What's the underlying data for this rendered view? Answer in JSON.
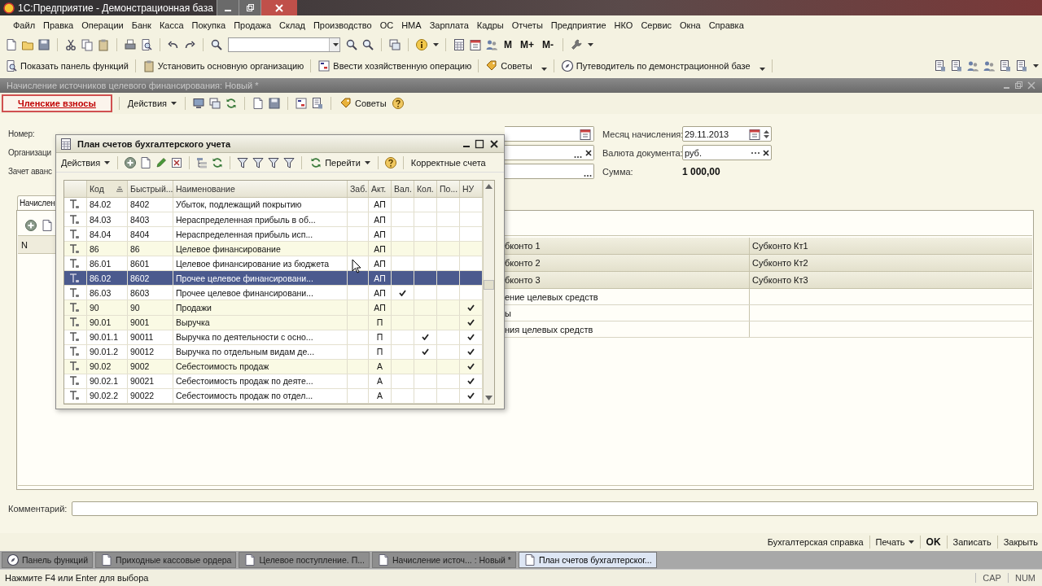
{
  "app_window": {
    "title": "1С:Предприятие - Демонстрационная база"
  },
  "menu": [
    "Файл",
    "Правка",
    "Операции",
    "Банк",
    "Касса",
    "Покупка",
    "Продажа",
    "Склад",
    "Производство",
    "ОС",
    "НМА",
    "Зарплата",
    "Кадры",
    "Отчеты",
    "Предприятие",
    "НКО",
    "Сервис",
    "Окна",
    "Справка"
  ],
  "toolbar": {
    "memory_buttons": [
      "M",
      "M+",
      "M-"
    ]
  },
  "function_bar": [
    {
      "label": "Показать панель функций",
      "dropdown": false
    },
    {
      "label": "Установить основную организацию",
      "dropdown": false
    },
    {
      "label": "Ввести хозяйственную операцию",
      "dropdown": false
    },
    {
      "label": "Советы",
      "dropdown": true
    },
    {
      "label": "Путеводитель по демонстрационной базе",
      "dropdown": true
    }
  ],
  "document": {
    "title": "Начисление источников целевого финансирования: Новый *",
    "toolbar": {
      "mode_button": "Членские взносы",
      "actions": "Действия",
      "tips": "Советы"
    },
    "left_labels": [
      "Номер:",
      "Организаци",
      "Зачет аванс"
    ],
    "right_fields": [
      {
        "label": "Месяц начисления:",
        "value": "29.11.2013",
        "kind": "date"
      },
      {
        "label": "Валюта документа:",
        "value": "руб.",
        "kind": "reference"
      },
      {
        "label": "Сумма:",
        "value": "1 000,00",
        "kind": "total"
      }
    ],
    "tab": {
      "label": "Начислен",
      "selected": true
    },
    "table": {
      "column_1": "N",
      "rows": [
        {
          "kind": "header",
          "column_2": "бконто 1",
          "column_3": "Субконто Кт1"
        },
        {
          "kind": "header",
          "column_2": "бконто 2",
          "column_3": "Субконто Кт2"
        },
        {
          "kind": "header",
          "column_2": "бконто 3",
          "column_3": "Субконто Кт3"
        },
        {
          "kind": "data",
          "column_2": "ение целевых средств"
        },
        {
          "kind": "data",
          "column_2": "ы"
        },
        {
          "kind": "data",
          "column_2": "ния целевых средств"
        }
      ]
    },
    "comment": {
      "label": "Комментарий:"
    },
    "buttons": [
      {
        "label": "Бухгалтерская справка",
        "dropdown": false,
        "default": false
      },
      {
        "label": "Печать",
        "dropdown": true,
        "default": false
      },
      {
        "label": "OK",
        "dropdown": false,
        "default": true
      },
      {
        "label": "Записать",
        "dropdown": false,
        "default": false
      },
      {
        "label": "Закрыть",
        "dropdown": false,
        "default": false
      }
    ]
  },
  "dialog": {
    "title": "План счетов бухгалтерского учета",
    "toolbar": {
      "actions": "Действия",
      "go": "Перейти",
      "correct": "Корректные счета"
    },
    "columns": [
      {
        "kind": "icon",
        "sorted": false
      },
      {
        "label": "Код",
        "kind": "text",
        "sorted": true
      },
      {
        "label": "Быстрый...",
        "kind": "text",
        "sorted": false
      },
      {
        "label": "Наименование",
        "kind": "text",
        "sorted": false
      },
      {
        "label": "Заб.",
        "kind": "check",
        "sorted": false
      },
      {
        "label": "Акт.",
        "kind": "center",
        "sorted": false
      },
      {
        "label": "Вал.",
        "kind": "check",
        "sorted": false
      },
      {
        "label": "Кол.",
        "kind": "check",
        "sorted": false
      },
      {
        "label": "По...",
        "kind": "check",
        "sorted": false
      },
      {
        "label": "НУ",
        "kind": "check",
        "sorted": false
      }
    ],
    "rows": [
      {
        "group": false,
        "selected": false,
        "values": [
          "84.02",
          "8402",
          "Убыток, подлежащий покрытию",
          false,
          "АП",
          false,
          false,
          false,
          false
        ]
      },
      {
        "group": false,
        "selected": false,
        "values": [
          "84.03",
          "8403",
          "Нераспределенная прибыль в об...",
          false,
          "АП",
          false,
          false,
          false,
          false
        ]
      },
      {
        "group": false,
        "selected": false,
        "values": [
          "84.04",
          "8404",
          "Нераспределенная прибыль исп...",
          false,
          "АП",
          false,
          false,
          false,
          false
        ]
      },
      {
        "group": true,
        "selected": false,
        "values": [
          "86",
          "86",
          "Целевое финансирование",
          false,
          "АП",
          false,
          false,
          false,
          false
        ]
      },
      {
        "group": false,
        "selected": false,
        "values": [
          "86.01",
          "8601",
          "Целевое финансирование из бюджета",
          false,
          "АП",
          false,
          false,
          false,
          false
        ]
      },
      {
        "group": false,
        "selected": true,
        "values": [
          "86.02",
          "8602",
          "Прочее целевое финансировани...",
          false,
          "АП",
          false,
          false,
          false,
          false
        ]
      },
      {
        "group": false,
        "selected": false,
        "values": [
          "86.03",
          "8603",
          "Прочее целевое финансировани...",
          false,
          "АП",
          true,
          false,
          false,
          false
        ]
      },
      {
        "group": true,
        "selected": false,
        "values": [
          "90",
          "90",
          "Продажи",
          false,
          "АП",
          false,
          false,
          false,
          true
        ]
      },
      {
        "group": true,
        "selected": false,
        "values": [
          "90.01",
          "9001",
          "Выручка",
          false,
          "П",
          false,
          false,
          false,
          true
        ]
      },
      {
        "group": false,
        "selected": false,
        "values": [
          "90.01.1",
          "90011",
          "Выручка по деятельности с осно...",
          false,
          "П",
          false,
          true,
          false,
          true
        ]
      },
      {
        "group": false,
        "selected": false,
        "values": [
          "90.01.2",
          "90012",
          "Выручка по отдельным видам де...",
          false,
          "П",
          false,
          true,
          false,
          true
        ]
      },
      {
        "group": true,
        "selected": false,
        "values": [
          "90.02",
          "9002",
          "Себестоимость продаж",
          false,
          "А",
          false,
          false,
          false,
          true
        ]
      },
      {
        "group": false,
        "selected": false,
        "values": [
          "90.02.1",
          "90021",
          "Себестоимость продаж по деяте...",
          false,
          "А",
          false,
          false,
          false,
          true
        ]
      },
      {
        "group": false,
        "selected": false,
        "values": [
          "90.02.2",
          "90022",
          "Себестоимость продаж по отдел...",
          false,
          "А",
          false,
          false,
          false,
          true
        ]
      }
    ]
  },
  "taskbar": [
    {
      "label": "Панель функций",
      "selected": false
    },
    {
      "label": "Приходные кассовые ордера",
      "selected": false
    },
    {
      "label": "Целевое поступление. П...",
      "selected": false
    },
    {
      "label": "Начисление источ... : Новый *",
      "selected": false
    },
    {
      "label": "План счетов бухгалтерског...",
      "selected": true
    }
  ],
  "status_bar": {
    "hint": "Нажмите F4 или Enter для выбора",
    "indicators": [
      "CAP",
      "NUM"
    ]
  }
}
